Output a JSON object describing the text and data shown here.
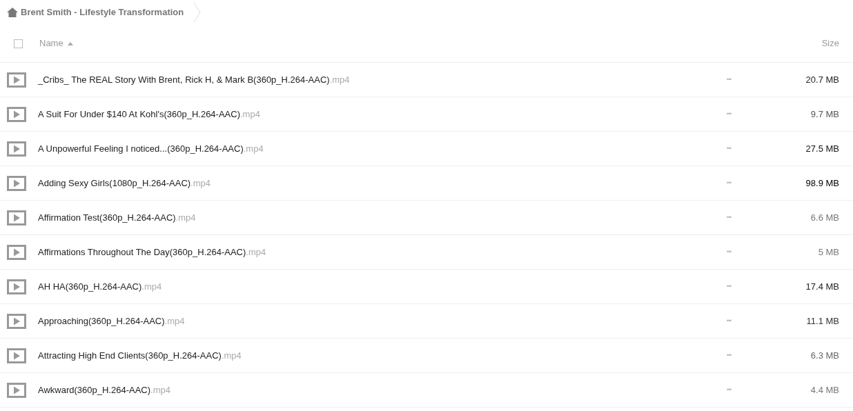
{
  "breadcrumb": {
    "label": "Brent Smith - Lifestyle Transformation"
  },
  "header": {
    "select_all_checked": false,
    "name_label": "Name",
    "sort_ascending": true,
    "size_label": "Size"
  },
  "files": [
    {
      "name": "_Cribs_ The REAL Story With Brent, Rick H, & Mark B(360p_H.264-AAC)",
      "extension": ".mp4",
      "actions": "•••",
      "size": "20.7 MB",
      "color": "#222222"
    },
    {
      "name": "A Suit For Under $140 At Kohl's(360p_H.264-AAC)",
      "extension": ".mp4",
      "actions": "•••",
      "size": "9.7 MB",
      "color": "#555555"
    },
    {
      "name": "A Unpowerful Feeling I noticed...(360p_H.264-AAC)",
      "extension": ".mp4",
      "actions": "•••",
      "size": "27.5 MB",
      "color": "#111111"
    },
    {
      "name": "Adding Sexy Girls(1080p_H.264-AAC)",
      "extension": ".mp4",
      "actions": "•••",
      "size": "98.9 MB",
      "color": "#000000"
    },
    {
      "name": "Affirmation Test(360p_H.264-AAC)",
      "extension": ".mp4",
      "actions": "•••",
      "size": "6.6 MB",
      "color": "#777777"
    },
    {
      "name": "Affirmations Throughout The Day(360p_H.264-AAC)",
      "extension": ".mp4",
      "actions": "•••",
      "size": "5 MB",
      "color": "#7a7a7a"
    },
    {
      "name": "AH HA(360p_H.264-AAC)",
      "extension": ".mp4",
      "actions": "•••",
      "size": "17.4 MB",
      "color": "#222222"
    },
    {
      "name": "Approaching(360p_H.264-AAC)",
      "extension": ".mp4",
      "actions": "•••",
      "size": "11.1 MB",
      "color": "#333333"
    },
    {
      "name": "Attracting High End Clients(360p_H.264-AAC)",
      "extension": ".mp4",
      "actions": "•••",
      "size": "6.3 MB",
      "color": "#666666"
    },
    {
      "name": "Awkward(360p_H.264-AAC)",
      "extension": ".mp4",
      "actions": "•••",
      "size": "4.4 MB",
      "color": "#777777"
    }
  ]
}
